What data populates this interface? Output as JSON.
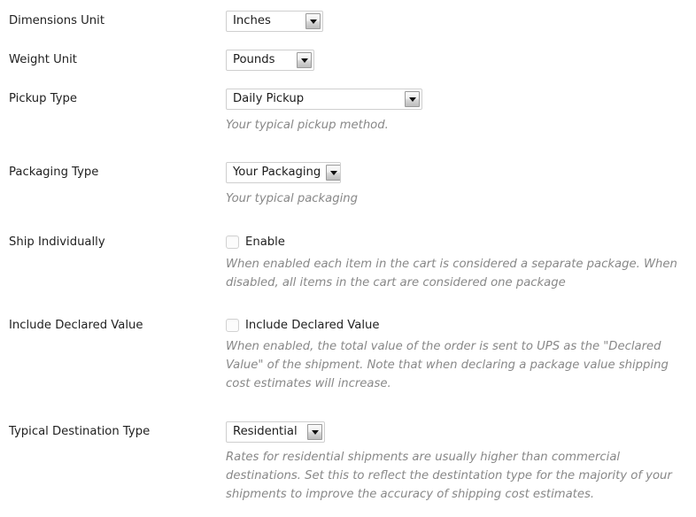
{
  "theme": {
    "page_background": "#ffffff",
    "label_color": "#222222",
    "description_color": "#888888",
    "field_border_color": "#cfcfcf",
    "checkbox_border_color": "#d2d2d2"
  },
  "settings_form": {
    "rows": [
      {
        "id": "dimensions-unit",
        "label": "Dimensions Unit",
        "control": "select",
        "value": "Inches",
        "description": ""
      },
      {
        "id": "weight-unit",
        "label": "Weight Unit",
        "control": "select",
        "value": "Pounds",
        "description": ""
      },
      {
        "id": "pickup-type",
        "label": "Pickup Type",
        "control": "select",
        "value": "Daily Pickup",
        "description": "Your typical pickup method."
      },
      {
        "id": "packaging-type",
        "label": "Packaging Type",
        "control": "select",
        "value": "Your Packaging",
        "description": "Your typical packaging"
      },
      {
        "id": "ship-individually",
        "label": "Ship Individually",
        "control": "checkbox",
        "checkbox_label": "Enable",
        "checked": false,
        "description": "When enabled each item in the cart is considered a separate package. When disabled, all items in the cart are considered one package"
      },
      {
        "id": "include-declared-value",
        "label": "Include Declared Value",
        "control": "checkbox",
        "checkbox_label": "Include Declared Value",
        "checked": false,
        "description": "When enabled, the total value of the order is sent to UPS as the \"Declared Value\" of the shipment. Note that when declaring a package value shipping cost estimates will increase."
      },
      {
        "id": "typical-destination-type",
        "label": "Typical Destination Type",
        "control": "select",
        "value": "Residential",
        "description": "Rates for residential shipments are usually higher than commercial destinations. Set this to reflect the destintation type for the majority of your shipments to improve the accuracy of shipping cost estimates."
      }
    ]
  },
  "icons": {
    "dropdown_arrow": "chevron-down-icon"
  }
}
